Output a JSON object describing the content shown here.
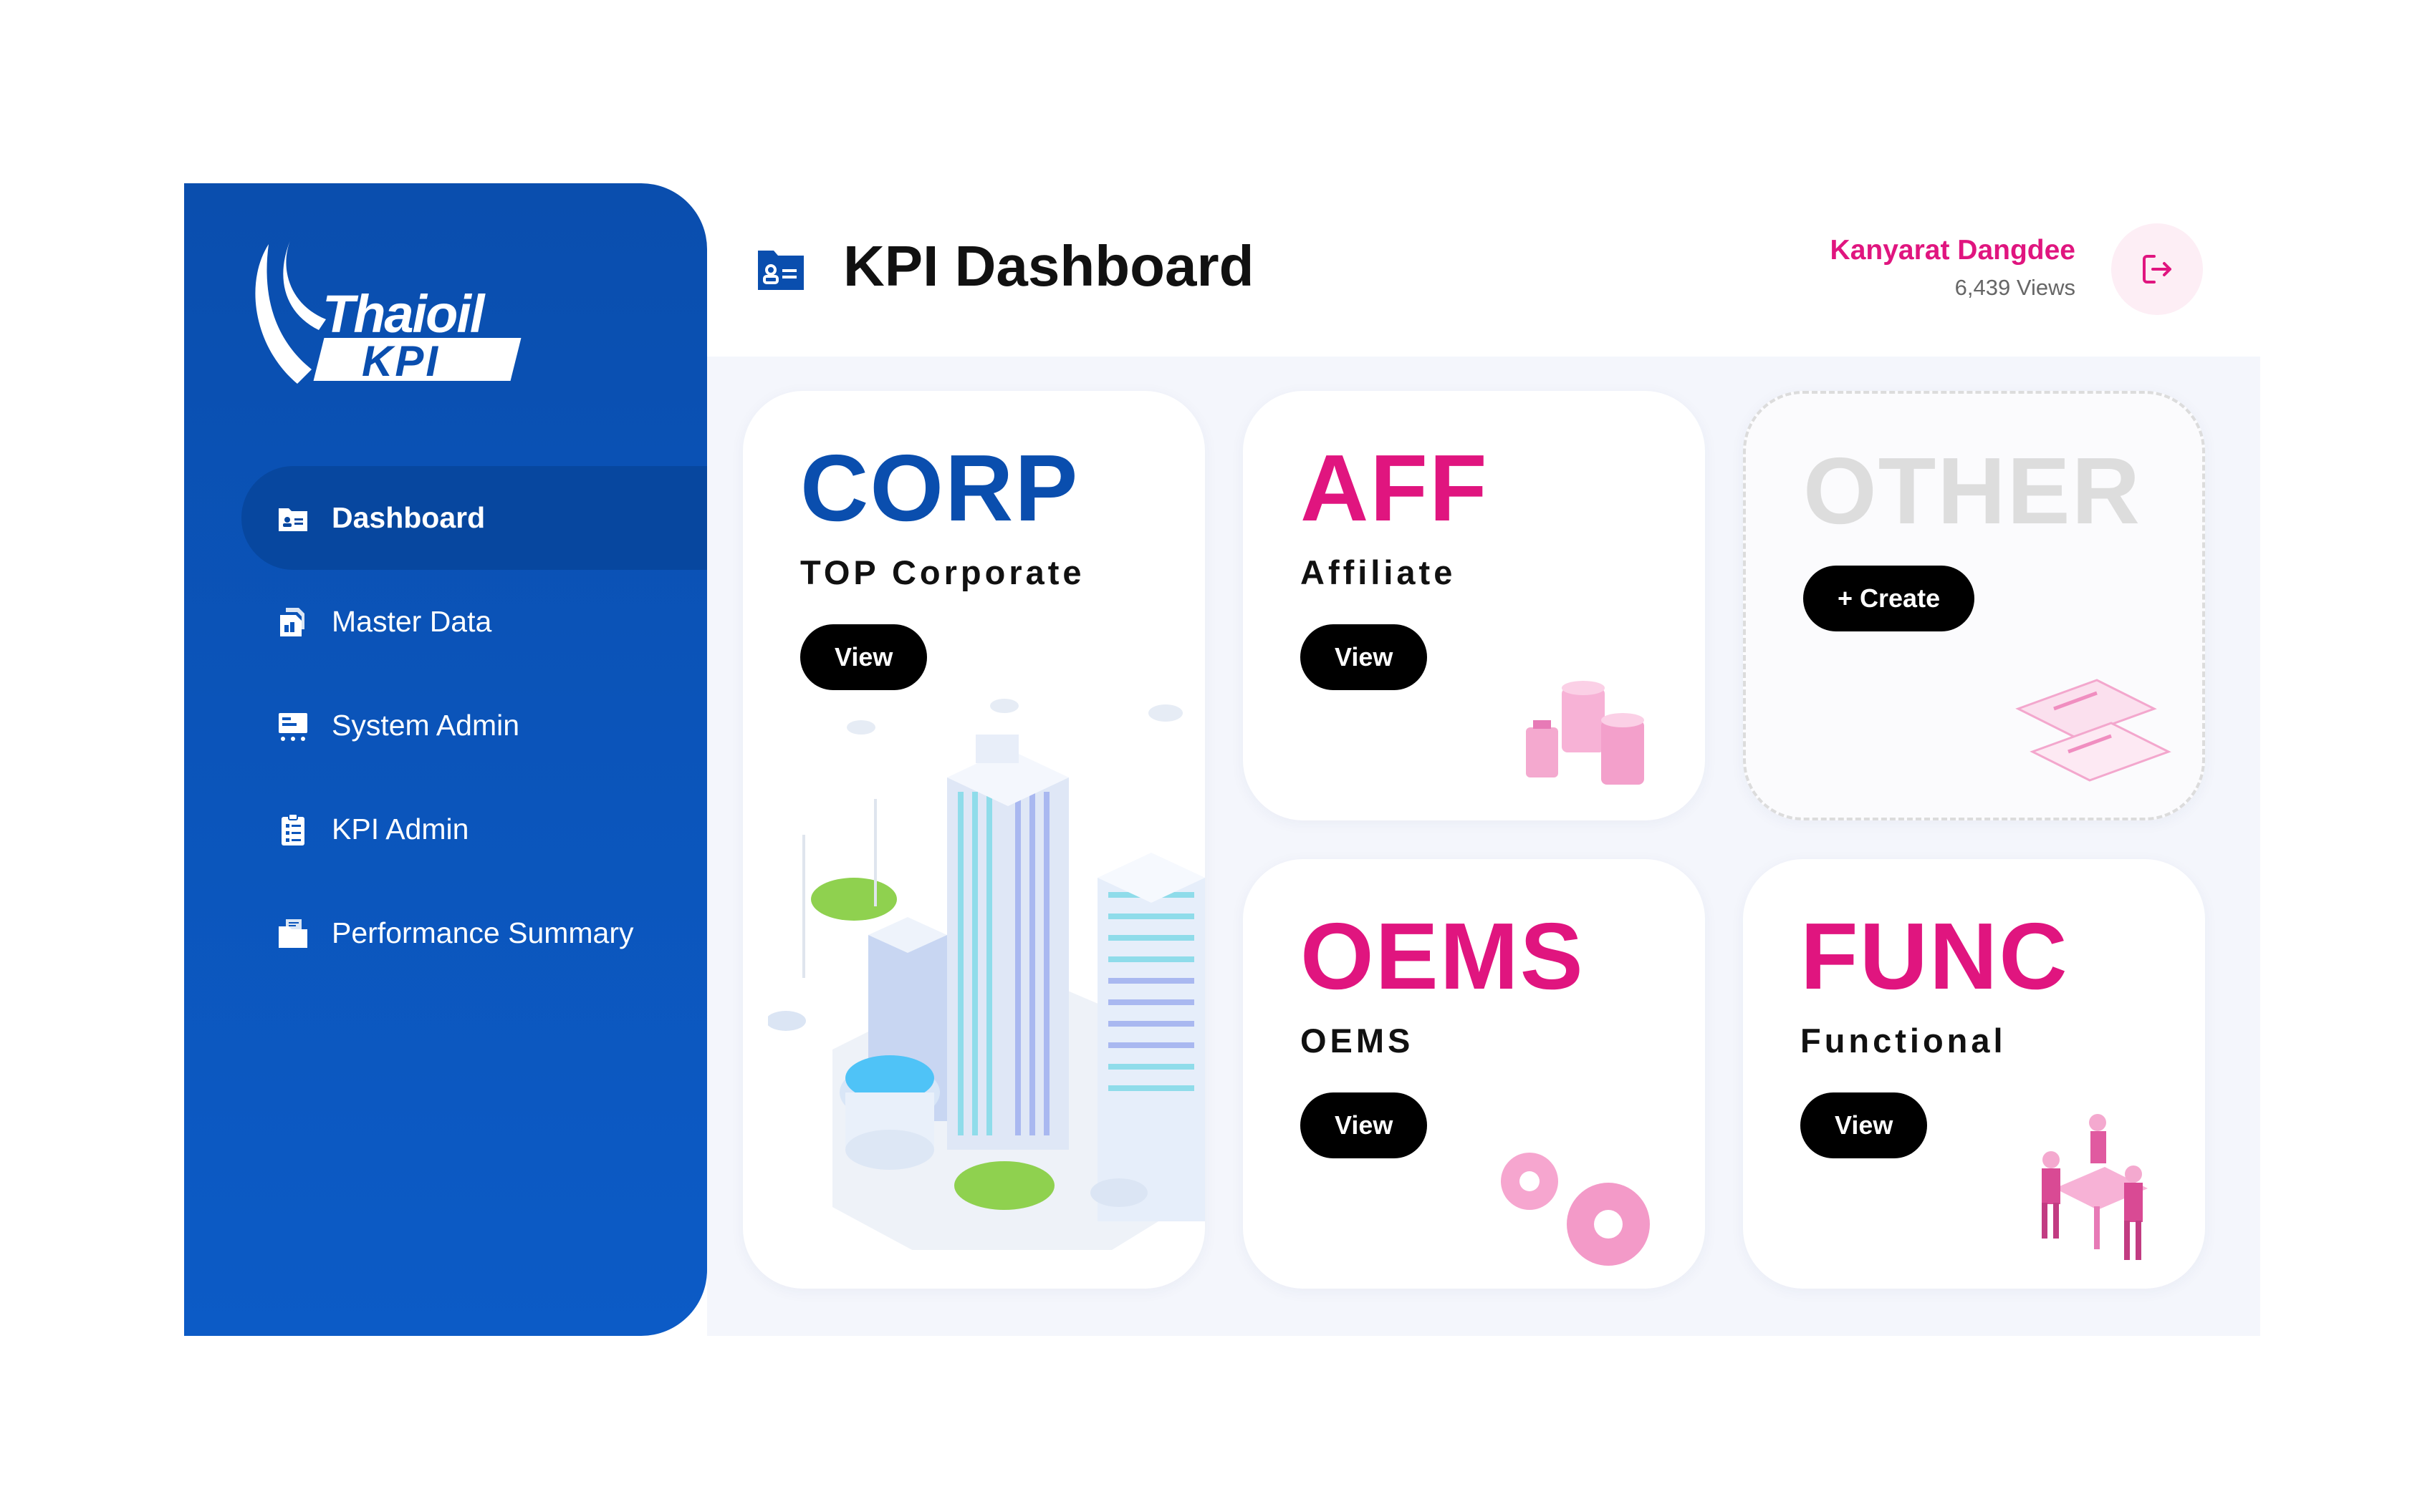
{
  "brand": {
    "logo_main": "Thaioil",
    "logo_sub": "KPI"
  },
  "sidebar": {
    "items": [
      {
        "label": "Dashboard",
        "icon": "dashboard-icon",
        "active": true
      },
      {
        "label": "Master Data",
        "icon": "master-data-icon",
        "active": false
      },
      {
        "label": "System Admin",
        "icon": "system-admin-icon",
        "active": false
      },
      {
        "label": "KPI Admin",
        "icon": "kpi-admin-icon",
        "active": false
      },
      {
        "label": "Performance Summary",
        "icon": "performance-summary-icon",
        "active": false
      }
    ]
  },
  "header": {
    "title": "KPI Dashboard",
    "user_name": "Kanyarat Dangdee",
    "views": "6,439 Views"
  },
  "cards": [
    {
      "code": "CORP",
      "subtitle": "TOP Corporate",
      "button": "View",
      "color": "#0a4eae"
    },
    {
      "code": "AFF",
      "subtitle": "Affiliate",
      "button": "View",
      "color": "#e0157f"
    },
    {
      "code": "OTHER",
      "subtitle": "",
      "button": "+ Create",
      "color": "#dddddd"
    },
    {
      "code": "OEMS",
      "subtitle": "OEMS",
      "button": "View",
      "color": "#e0157f"
    },
    {
      "code": "FUNC",
      "subtitle": "Functional",
      "button": "View",
      "color": "#e0157f"
    }
  ],
  "colors": {
    "primary_blue": "#0a4eae",
    "accent_pink": "#e0157f",
    "button_black": "#000000"
  }
}
